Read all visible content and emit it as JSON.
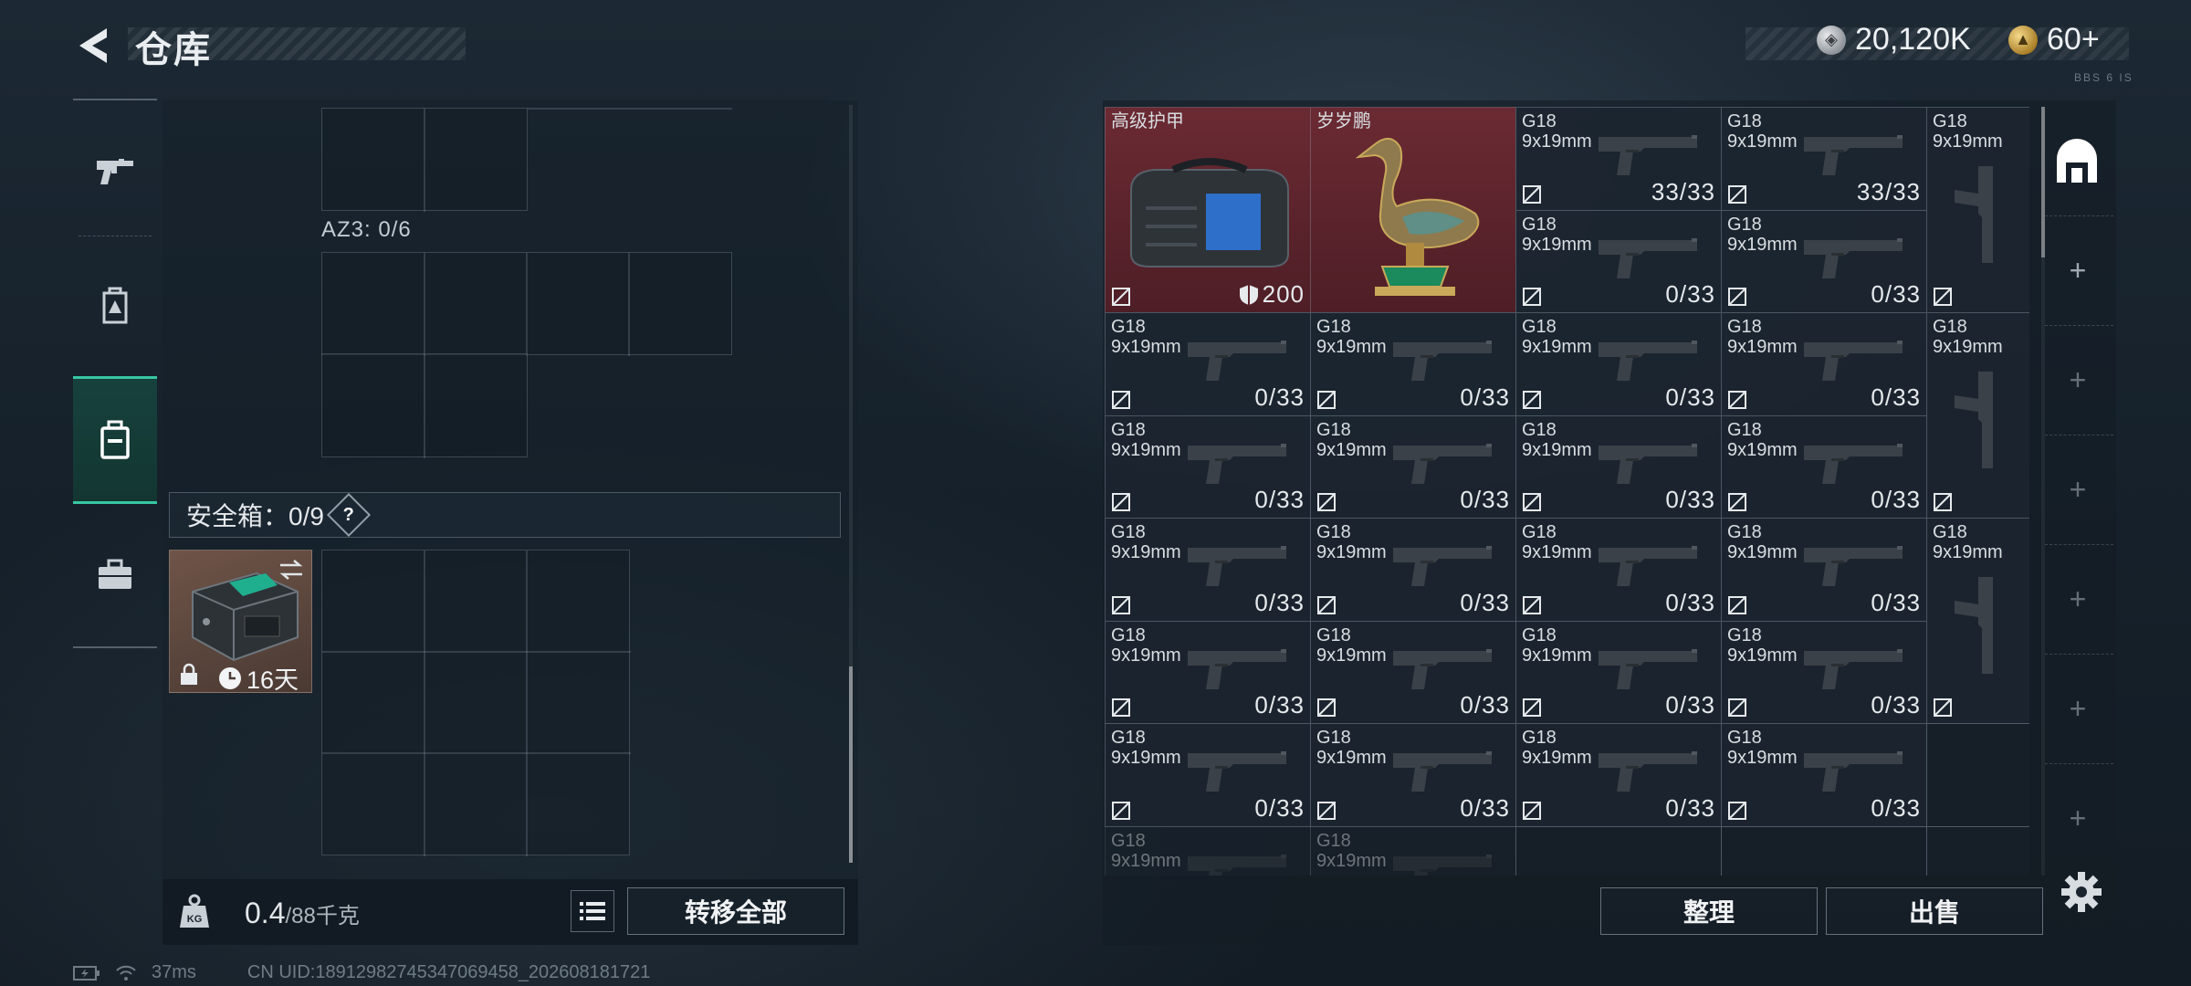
{
  "header": {
    "title": "仓库"
  },
  "currency": {
    "silver": "20,120K",
    "gold": "60+"
  },
  "version_hint": "BBS 6 IS",
  "left": {
    "container_label": "AZ3: 0/6",
    "safe_box_label": "安全箱：0/9",
    "help": "?",
    "safe_box_days": "16天",
    "weight_current": "0.4",
    "weight_max": "/88千克",
    "transfer_all": "转移全部",
    "weight_icon": "KG"
  },
  "right": {
    "sort_label": "整理",
    "sell_label": "出售"
  },
  "items": {
    "armor_name": "高级护甲",
    "armor_value": "200",
    "duck_name": "岁岁鹏",
    "gun_name": "G18",
    "gun_caliber": "9x19mm",
    "full": "33/33",
    "empty": "0/33"
  },
  "status": {
    "ping": "37ms",
    "uid": "CN UID:1891298274534706945​8_202608181721"
  }
}
